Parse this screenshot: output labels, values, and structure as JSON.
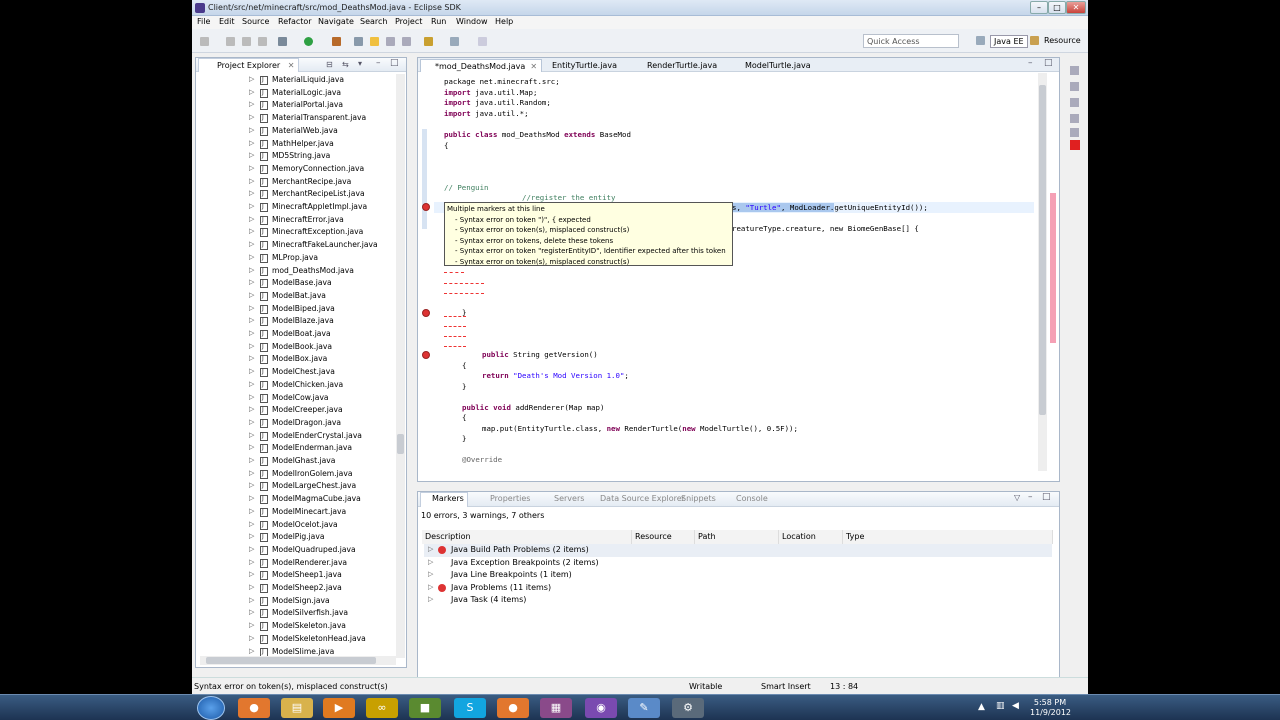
{
  "window": {
    "title": "Client/src/net/minecraft/src/mod_DeathsMod.java - Eclipse SDK",
    "minimize": "–",
    "maximize": "□",
    "close": "✕"
  },
  "menu": [
    "File",
    "Edit",
    "Source",
    "Refactor",
    "Navigate",
    "Search",
    "Project",
    "Run",
    "Window",
    "Help"
  ],
  "toolbar": {
    "quick_access_placeholder": "Quick Access",
    "perspective_java_ee": "Java EE",
    "perspective_resource": "Resource"
  },
  "project_explorer": {
    "tab": "Project Explorer",
    "files": [
      "MaterialLiquid.java",
      "MaterialLogic.java",
      "MaterialPortal.java",
      "MaterialTransparent.java",
      "MaterialWeb.java",
      "MathHelper.java",
      "MD5String.java",
      "MemoryConnection.java",
      "MerchantRecipe.java",
      "MerchantRecipeList.java",
      "MinecraftAppletImpl.java",
      "MinecraftError.java",
      "MinecraftException.java",
      "MinecraftFakeLauncher.java",
      "MLProp.java",
      "mod_DeathsMod.java",
      "ModelBase.java",
      "ModelBat.java",
      "ModelBiped.java",
      "ModelBlaze.java",
      "ModelBoat.java",
      "ModelBook.java",
      "ModelBox.java",
      "ModelChest.java",
      "ModelChicken.java",
      "ModelCow.java",
      "ModelCreeper.java",
      "ModelDragon.java",
      "ModelEnderCrystal.java",
      "ModelEnderman.java",
      "ModelGhast.java",
      "ModelIronGolem.java",
      "ModelLargeChest.java",
      "ModelMagmaCube.java",
      "ModelMinecart.java",
      "ModelOcelot.java",
      "ModelPig.java",
      "ModelQuadruped.java",
      "ModelRenderer.java",
      "ModelSheep1.java",
      "ModelSheep2.java",
      "ModelSign.java",
      "ModelSilverfish.java",
      "ModelSkeleton.java",
      "ModelSkeletonHead.java",
      "ModelSlime.java"
    ]
  },
  "editor": {
    "tabs": [
      "*mod_DeathsMod.java",
      "EntityTurtle.java",
      "RenderTurtle.java",
      "ModelTurtle.java"
    ],
    "lines": {
      "l1": "package net.minecraft.src;",
      "l2a": "import",
      "l2b": " java.util.Map;",
      "l3a": "import",
      "l3b": " java.util.Random;",
      "l4a": "import",
      "l4b": " java.util.*;",
      "l5a": "public class",
      "l5b": " mod_DeathsMod ",
      "l5c": "extends",
      "l5d": " BaseMod",
      "l6": "{",
      "l7": "// Penguin",
      "l8": "//register the entity",
      "l9a": "s, ",
      "l9b": "\"Turtle\"",
      "l9c": ", ModLoader.",
      "l9d": "getUniqueEntityId());",
      "l10": "reatureType.creature, new BiomeGenBase[] {",
      "l11": "}",
      "l12a": "public",
      "l12b": " String getVersion()",
      "l13": "{",
      "l14a": "return",
      "l14b": "\"Death's Mod Version 1.0\"",
      "l14c": ";",
      "l15": "}",
      "l16a": "public void",
      "l16b": " addRenderer(Map map)",
      "l17": "{",
      "l18a": "map.put(EntityTurtle.class, ",
      "l18b": "new",
      "l18c": " RenderTurtle(",
      "l18d": "new",
      "l18e": " ModelTurtle(), 0.5F));",
      "l19": "}",
      "l20": "@Override"
    },
    "tooltip": [
      "Multiple markers at this line",
      "- Syntax error on token \")\", { expected",
      "- Syntax error on token(s), misplaced construct(s)",
      "- Syntax error on tokens, delete these tokens",
      "- Syntax error on token \"registerEntityID\", Identifier expected after this token",
      "- Syntax error on token(s), misplaced construct(s)"
    ]
  },
  "markers": {
    "tabs": [
      "Markers",
      "Properties",
      "Servers",
      "Data Source Explorer",
      "Snippets",
      "Console"
    ],
    "summary": "10 errors, 3 warnings, 7 others",
    "columns": [
      "Description",
      "Resource",
      "Path",
      "Location",
      "Type"
    ],
    "rows": [
      {
        "label": "Java Build Path Problems (2 items)",
        "error": true
      },
      {
        "label": "Java Exception Breakpoints (2 items)",
        "error": false
      },
      {
        "label": "Java Line Breakpoints (1 item)",
        "error": false
      },
      {
        "label": "Java Problems (11 items)",
        "error": true
      },
      {
        "label": "Java Task (4 items)",
        "error": false
      }
    ]
  },
  "status": {
    "message": "Syntax error on token(s), misplaced construct(s)",
    "writable": "Writable",
    "insert_mode": "Smart Insert",
    "position": "13 : 84"
  },
  "taskbar": {
    "time": "5:58 PM",
    "date": "11/9/2012"
  }
}
